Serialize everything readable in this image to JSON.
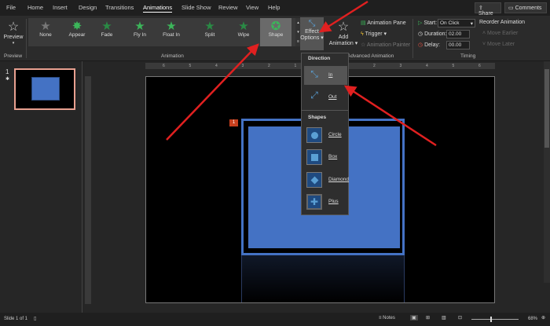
{
  "tabs": [
    "File",
    "Home",
    "Insert",
    "Design",
    "Transitions",
    "Animations",
    "Slide Show",
    "Review",
    "View",
    "Help"
  ],
  "active_tab": "Animations",
  "share": "Share",
  "comments": "Comments",
  "preview": {
    "label": "Preview",
    "group": "Preview"
  },
  "animations": [
    "None",
    "Appear",
    "Fade",
    "Fly In",
    "Float In",
    "Split",
    "Wipe",
    "Shape"
  ],
  "selected_animation": "Shape",
  "group_animation": "Animation",
  "effect_options": {
    "line1": "Effect",
    "line2": "Options"
  },
  "add_animation": {
    "line1": "Add",
    "line2": "Animation"
  },
  "advanced": {
    "pane": "Animation Pane",
    "trigger": "Trigger",
    "painter": "Animation Painter",
    "group": "Advanced Animation"
  },
  "timing": {
    "start_label": "Start:",
    "start_value": "On Click",
    "duration_label": "Duration:",
    "duration_value": "02.00",
    "delay_label": "Delay:",
    "delay_value": "00.00",
    "group": "Timing"
  },
  "reorder": {
    "title": "Reorder Animation",
    "earlier": "Move Earlier",
    "later": "Move Later"
  },
  "thumbnail": {
    "number": "1"
  },
  "ruler_h": [
    "6",
    "5",
    "4",
    "3",
    "2",
    "1",
    "0",
    "1",
    "2",
    "3",
    "4",
    "5",
    "6"
  ],
  "menu": {
    "direction": "Direction",
    "in": "In",
    "out": "Out",
    "shapes": "Shapes",
    "circle": "Circle",
    "box": "Box",
    "diamond": "Diamond",
    "plus": "Plus"
  },
  "anim_marker": "1",
  "status": {
    "slide": "Slide 1 of 1",
    "notes": "Notes",
    "zoom": "68%"
  },
  "colors": {
    "accent": "#4472c4",
    "arrow": "#e02020",
    "marker": "#c8401e"
  }
}
